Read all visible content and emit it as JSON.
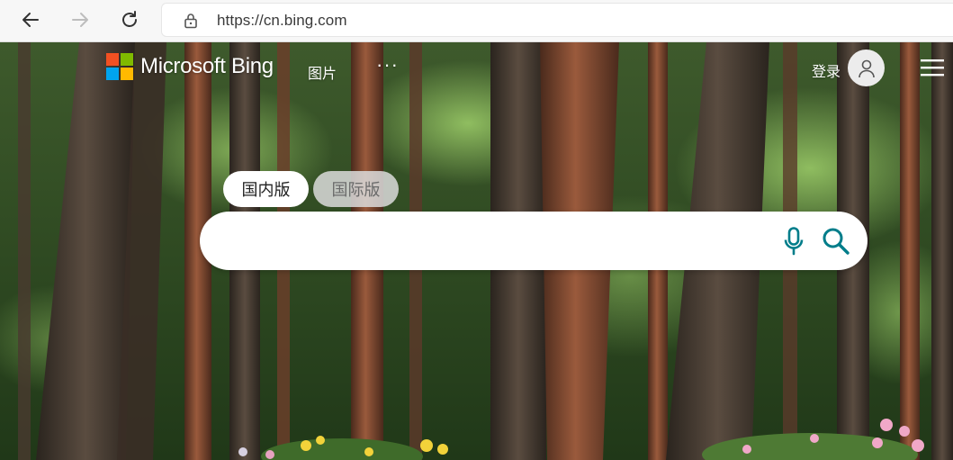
{
  "browser": {
    "url": "https://cn.bing.com",
    "back_icon": "arrow-left-icon",
    "forward_icon": "arrow-right-icon",
    "refresh_icon": "refresh-icon",
    "lock_icon": "lock-icon"
  },
  "header": {
    "brand": "Microsoft Bing",
    "nav_images": "图片",
    "nav_more": "···",
    "signin": "登录",
    "logo_colors": [
      "#f25022",
      "#7fba00",
      "#00a4ef",
      "#ffb900"
    ]
  },
  "search": {
    "tabs": [
      {
        "label": "国内版",
        "active": true
      },
      {
        "label": "国际版",
        "active": false
      }
    ],
    "input_value": "",
    "mic_icon": "microphone-icon",
    "search_icon": "search-icon",
    "accent_color": "#007d8a"
  }
}
